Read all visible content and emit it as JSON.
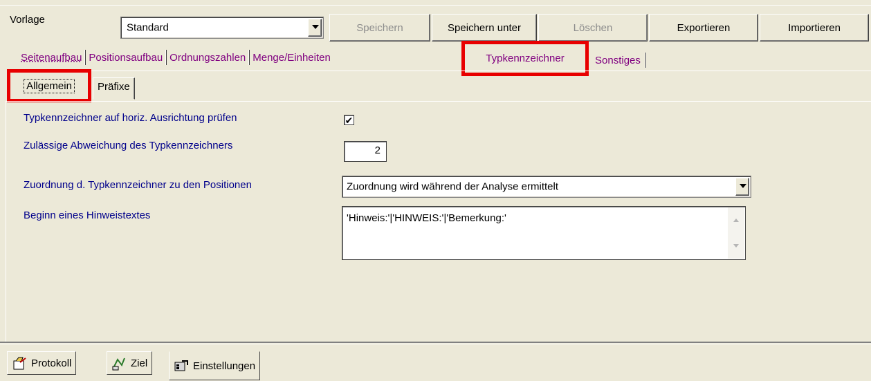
{
  "toolbar": {
    "vorlage_label": "Vorlage",
    "template_value": "Standard",
    "buttons": {
      "save": "Speichern",
      "save_as": "Speichern unter",
      "delete": "Löschen",
      "export": "Exportieren",
      "import": "Importieren"
    }
  },
  "main_tabs": [
    "Seitenaufbau",
    "Positionsaufbau",
    "Ordnungszahlen",
    "Menge/Einheiten",
    "Typkennzeichner",
    "Sonstiges"
  ],
  "active_main_tab": "Typkennzeichner",
  "sub_tabs": [
    "Allgemein",
    "Präfixe"
  ],
  "active_sub_tab": "Allgemein",
  "form": {
    "check_horizontal_label": "Typkennzeichner auf horiz. Ausrichtung prüfen",
    "check_horizontal_checked": true,
    "deviation_label": "Zulässige Abweichung des Typkennzeichners",
    "deviation_value": "2",
    "assignment_label": "Zuordnung d. Typkennzeichner zu den Positionen",
    "assignment_value": "Zuordnung wird während der Analyse ermittelt",
    "hint_label": "Beginn eines Hinweistextes",
    "hint_value": "'Hinweis:'|'HINWEIS:'|'Bemerkung:'"
  },
  "bottom_tabs": [
    "Protokoll",
    "Ziel",
    "Einstellungen"
  ],
  "active_bottom_tab": "Einstellungen",
  "colors": {
    "tab_text": "#800080",
    "label_text": "#00008b",
    "highlight": "#e80000"
  }
}
